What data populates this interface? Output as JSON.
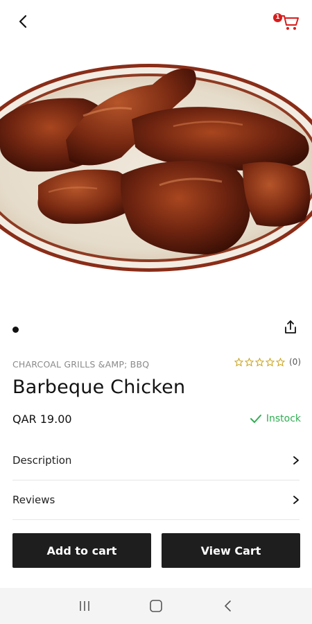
{
  "header": {
    "back_icon": "chevron-left-icon",
    "cart_icon": "shopping-cart-icon",
    "cart_count": "1",
    "accent_color": "#d91c1c"
  },
  "gallery": {
    "image_description_icon": "product-photo",
    "page_count": 1,
    "active_page": 1,
    "share_icon": "share-icon"
  },
  "product": {
    "category": "CHARCOAL GRILLS &AMP; BBQ",
    "rating": 0,
    "rating_count": "(0)",
    "name": "Barbeque Chicken",
    "price": "QAR 19.00",
    "stock_status": "Instock",
    "stock_color": "#2fae52"
  },
  "sections": {
    "description_label": "Description",
    "reviews_label": "Reviews"
  },
  "actions": {
    "add_to_cart_label": "Add to cart",
    "view_cart_label": "View Cart"
  },
  "system_nav": {
    "recents_icon": "recents-icon",
    "home_icon": "home-icon",
    "back_icon": "back-icon"
  }
}
